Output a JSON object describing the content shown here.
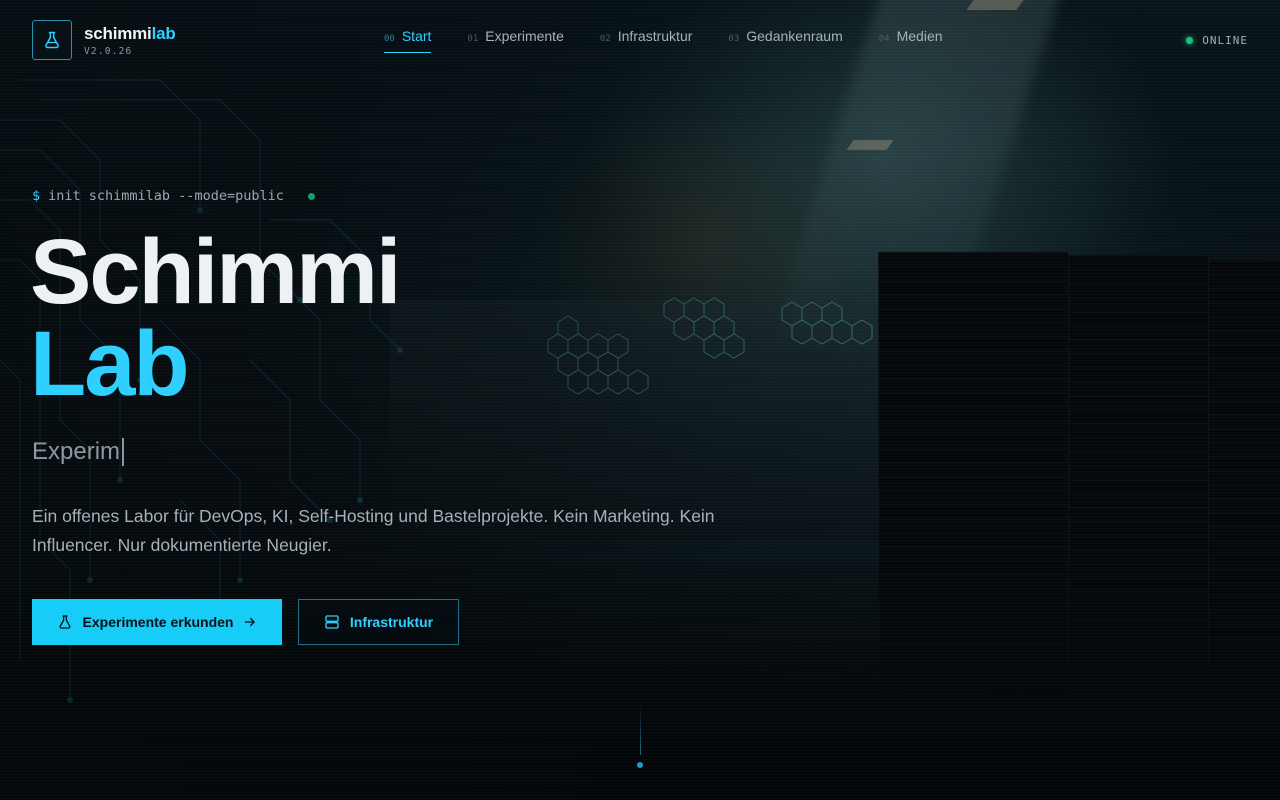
{
  "brand": {
    "name_main": "schimmi",
    "name_accent": "lab",
    "version": "V2.0.26",
    "icon": "flask-icon",
    "accent_color": "#2fd0ff"
  },
  "nav": {
    "items": [
      {
        "num": "00",
        "label": "Start",
        "active": true
      },
      {
        "num": "01",
        "label": "Experimente",
        "active": false
      },
      {
        "num": "02",
        "label": "Infrastruktur",
        "active": false
      },
      {
        "num": "03",
        "label": "Gedankenraum",
        "active": false
      },
      {
        "num": "04",
        "label": "Medien",
        "active": false
      }
    ]
  },
  "status": {
    "label": "ONLINE",
    "color": "#19c37d"
  },
  "hero": {
    "command_prompt": "$",
    "command": "init schimmilab --mode=public",
    "title_line1": "Schimmi",
    "title_line2": "Lab",
    "typed_text": "Experim",
    "description": "Ein offenes Labor für DevOps, KI, Self-Hosting und Bastelprojekte. Kein Marketing. Kein Influencer. Nur dokumentierte Neugier.",
    "primary_button": {
      "label": "Experimente erkunden",
      "icon": "flask-icon",
      "trailing_icon": "arrow-right-icon"
    },
    "secondary_button": {
      "label": "Infrastruktur",
      "icon": "server-icon"
    }
  }
}
